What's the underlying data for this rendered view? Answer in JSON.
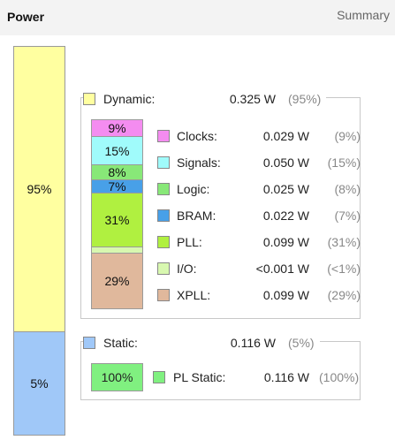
{
  "header": {
    "title": "Power",
    "summary_link": "Summary"
  },
  "total_bar": {
    "dynamic_pct": "95%",
    "static_pct": "5%",
    "dynamic_fraction": 0.95,
    "static_fraction": 0.05
  },
  "dynamic": {
    "label": "Dynamic:",
    "value": "0.325 W",
    "pct": "(95%)",
    "color": "#ffffa0",
    "items": [
      {
        "name": "Clocks:",
        "value": "0.029 W",
        "pct": "(9%)",
        "bar_label": "9%",
        "share": 9,
        "color": "#f48cf0"
      },
      {
        "name": "Signals:",
        "value": "0.050 W",
        "pct": "(15%)",
        "bar_label": "15%",
        "share": 15,
        "color": "#a0fbfb"
      },
      {
        "name": "Logic:",
        "value": "0.025 W",
        "pct": "(8%)",
        "bar_label": "8%",
        "share": 8,
        "color": "#88e878"
      },
      {
        "name": "BRAM:",
        "value": "0.022 W",
        "pct": "(7%)",
        "bar_label": "7%",
        "share": 7,
        "color": "#48a0e8"
      },
      {
        "name": "PLL:",
        "value": "0.099 W",
        "pct": "(31%)",
        "bar_label": "31%",
        "share": 31,
        "color": "#b0f040"
      },
      {
        "name": "I/O:",
        "value": "<0.001 W",
        "pct": "(<1%)",
        "bar_label": "",
        "share": 1,
        "color": "#d8f8b0"
      },
      {
        "name": "XPLL:",
        "value": "0.099 W",
        "pct": "(29%)",
        "bar_label": "29%",
        "share": 29,
        "color": "#e0b89c"
      }
    ]
  },
  "static": {
    "label": "Static:",
    "value": "0.116 W",
    "pct": "(5%)",
    "color": "#a0c8f8",
    "items": [
      {
        "name": "PL Static:",
        "value": "0.116 W",
        "pct": "(100%)",
        "bar_label": "100%",
        "color": "#80f080"
      }
    ]
  }
}
